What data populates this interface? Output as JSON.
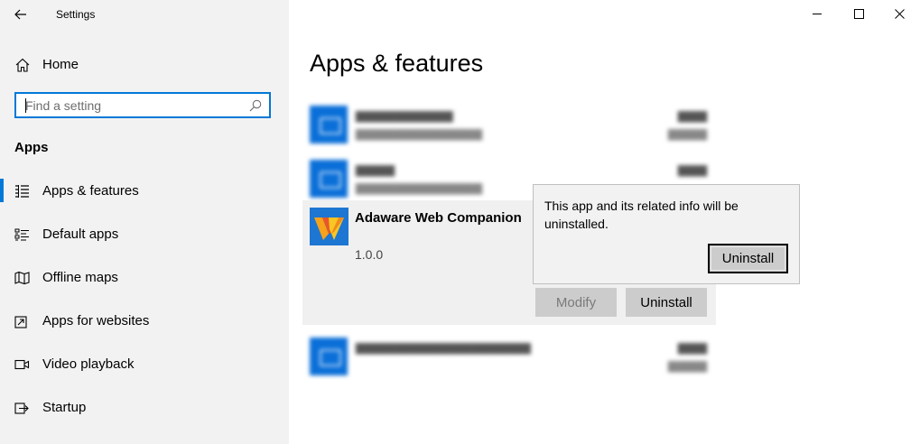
{
  "window": {
    "title": "Settings",
    "back_icon": "back-arrow-icon",
    "controls": [
      "minimize-icon",
      "maximize-icon",
      "close-icon"
    ]
  },
  "sidebar": {
    "home_label": "Home",
    "search_placeholder": "Find a setting",
    "section_heading": "Apps",
    "items": [
      {
        "label": "Apps & features",
        "icon": "apps-features-icon",
        "selected": true
      },
      {
        "label": "Default apps",
        "icon": "default-apps-icon",
        "selected": false
      },
      {
        "label": "Offline maps",
        "icon": "map-icon",
        "selected": false
      },
      {
        "label": "Apps for websites",
        "icon": "apps-websites-icon",
        "selected": false
      },
      {
        "label": "Video playback",
        "icon": "video-icon",
        "selected": false
      },
      {
        "label": "Startup",
        "icon": "startup-icon",
        "selected": false
      }
    ],
    "accent_color": "#0078d7"
  },
  "main": {
    "title": "Apps & features",
    "selected_app": {
      "name": "Adaware Web Companion",
      "version": "1.0.0",
      "modify_label": "Modify",
      "uninstall_label": "Uninstall"
    },
    "flyout": {
      "message": "This app and its related info will be uninstalled.",
      "confirm_label": "Uninstall"
    }
  }
}
